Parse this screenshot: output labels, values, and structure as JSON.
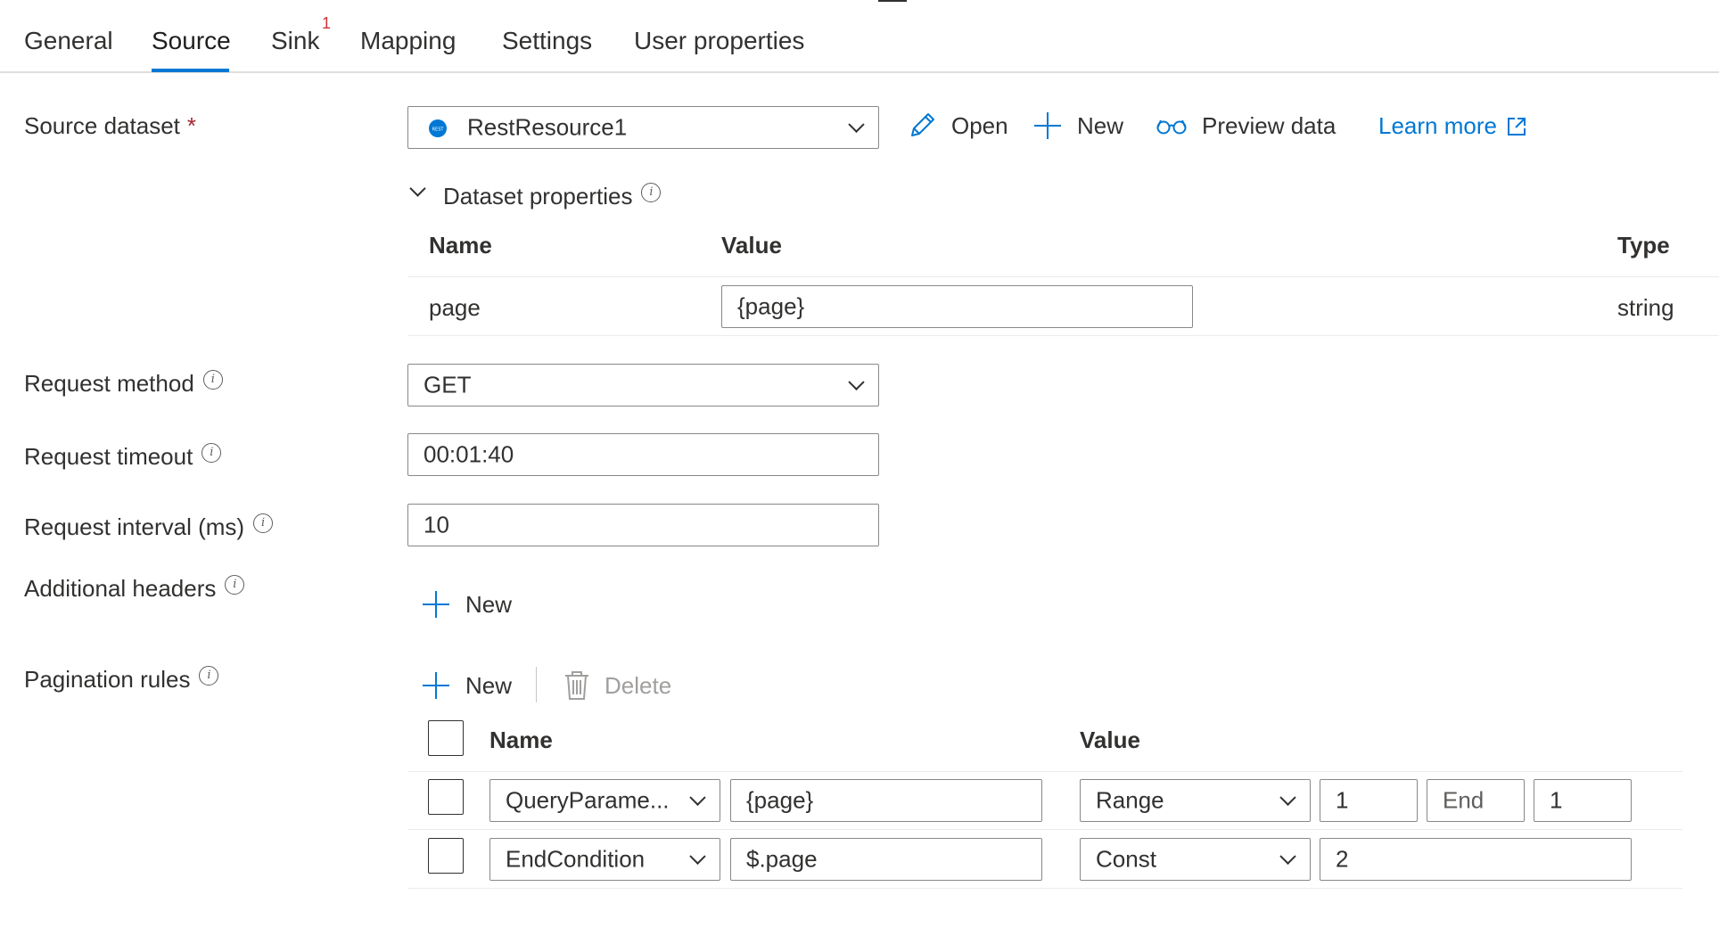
{
  "tabs": [
    {
      "label": "General"
    },
    {
      "label": "Source"
    },
    {
      "label": "Sink",
      "badge": "1"
    },
    {
      "label": "Mapping"
    },
    {
      "label": "Settings"
    },
    {
      "label": "User properties"
    }
  ],
  "source_dataset": {
    "label": "Source dataset",
    "required_mark": "*",
    "value": "RestResource1",
    "dataset_icon_text": "REST"
  },
  "toolbar": {
    "open": "Open",
    "new": "New",
    "preview": "Preview data",
    "learn_more": "Learn more"
  },
  "dataset_properties": {
    "title": "Dataset properties",
    "columns": [
      "Name",
      "Value",
      "Type"
    ],
    "rows": [
      {
        "name": "page",
        "value": "{page}",
        "type": "string"
      }
    ]
  },
  "request_method": {
    "label": "Request method",
    "value": "GET"
  },
  "request_timeout": {
    "label": "Request timeout",
    "value": "00:01:40"
  },
  "request_interval": {
    "label": "Request interval (ms)",
    "value": "10"
  },
  "additional_headers": {
    "label": "Additional headers",
    "new": "New"
  },
  "pagination": {
    "label": "Pagination rules",
    "new": "New",
    "delete": "Delete",
    "columns": [
      "Name",
      "Value"
    ],
    "rows": [
      {
        "name": "QueryParame...",
        "key": "{page}",
        "type": "Range",
        "v1": "1",
        "v2": "End",
        "v3": "1"
      },
      {
        "name": "EndCondition",
        "key": "$.page",
        "type": "Const",
        "v1": "2"
      }
    ]
  },
  "colors": {
    "accent": "#0078d4",
    "required": "#a4262c",
    "badge": "#d13438"
  }
}
